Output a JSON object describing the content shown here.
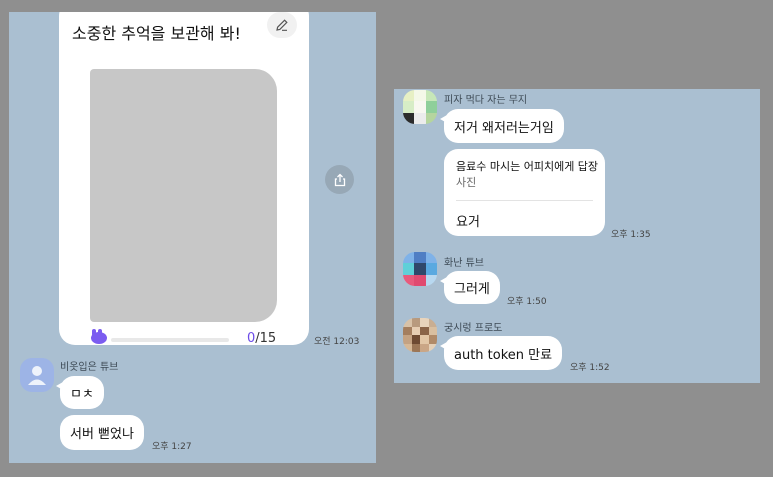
{
  "left": {
    "card": {
      "title": "소중한 추억을 보관해 봐!",
      "progress_current": "0",
      "progress_total": "/15",
      "progress_fraction": 0.0,
      "time": "오전 12:03"
    },
    "messages": [
      {
        "sender": "비옷입은 튜브",
        "bubbles": [
          "ㅁㅊ",
          "서버 뻗었나"
        ],
        "time": "오후 1:27"
      }
    ]
  },
  "right": {
    "messages": [
      {
        "sender": "피자 먹다 자는 무지",
        "bubble": "저거 왜저러는거임",
        "reply": {
          "title": "음료수 마시는 어피치에게 답장",
          "subtitle": "사진",
          "text": "요거"
        },
        "time": "오후 1:35"
      },
      {
        "sender": "화난 튜브",
        "bubble": "그러게",
        "time": "오후 1:50"
      },
      {
        "sender": "궁시렁 프로도",
        "bubble": "auth token 만료",
        "time": "오후 1:52"
      }
    ]
  },
  "icons": {
    "edit": "pencil-icon",
    "share": "share-icon",
    "progress": "character-icon",
    "avatar_default": "person-icon"
  },
  "colors": {
    "chat_background": "#aabfd1",
    "page_background": "#8f8f8f",
    "accent": "#6c4be8",
    "bubble": "#ffffff"
  }
}
